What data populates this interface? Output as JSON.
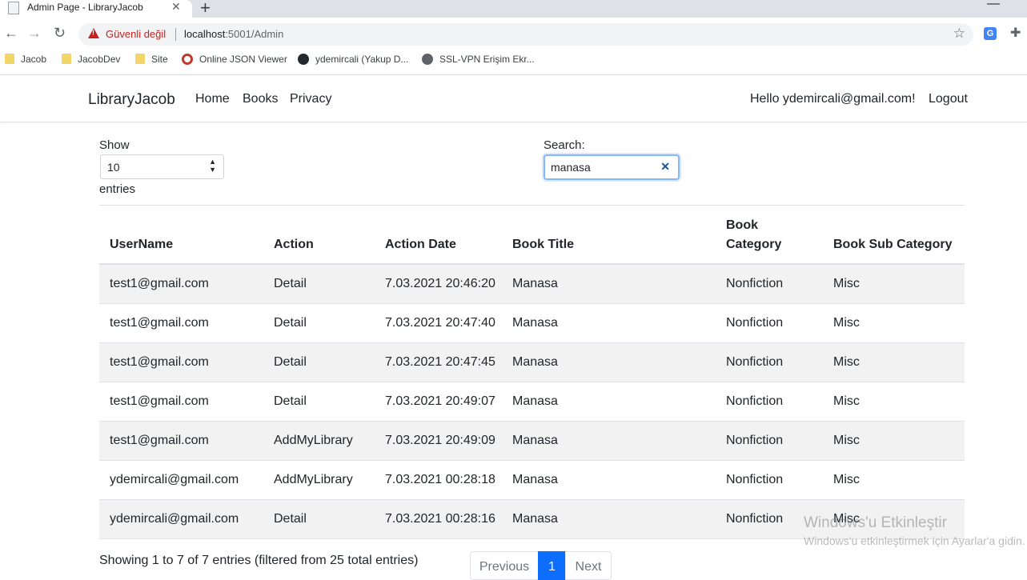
{
  "browser": {
    "tab_title": "Admin Page - LibraryJacob",
    "insecure_label": "Güvenli değil",
    "url_host": "localhost",
    "url_path": ":5001/Admin",
    "bookmarks": [
      "Jacob",
      "JacobDev",
      "Site",
      "Online JSON Viewer",
      "ydemircali (Yakup D...",
      "SSL-VPN Erişim Ekr..."
    ]
  },
  "navbar": {
    "brand": "LibraryJacob",
    "links": [
      "Home",
      "Books",
      "Privacy"
    ],
    "greeting": "Hello ydemircali@gmail.com!",
    "logout": "Logout"
  },
  "controls": {
    "show_label": "Show",
    "length_value": "10",
    "entries_label": "entries",
    "search_label": "Search:",
    "search_value": "manasa"
  },
  "table": {
    "headers": [
      "UserName",
      "Action",
      "Action Date",
      "Book Title",
      "Book Category",
      "Book Sub Category"
    ],
    "rows": [
      [
        "test1@gmail.com",
        "Detail",
        "7.03.2021 20:46:20",
        "Manasa",
        "Nonfiction",
        "Misc"
      ],
      [
        "test1@gmail.com",
        "Detail",
        "7.03.2021 20:47:40",
        "Manasa",
        "Nonfiction",
        "Misc"
      ],
      [
        "test1@gmail.com",
        "Detail",
        "7.03.2021 20:47:45",
        "Manasa",
        "Nonfiction",
        "Misc"
      ],
      [
        "test1@gmail.com",
        "Detail",
        "7.03.2021 20:49:07",
        "Manasa",
        "Nonfiction",
        "Misc"
      ],
      [
        "test1@gmail.com",
        "AddMyLibrary",
        "7.03.2021 20:49:09",
        "Manasa",
        "Nonfiction",
        "Misc"
      ],
      [
        "ydemircali@gmail.com",
        "AddMyLibrary",
        "7.03.2021 00:28:18",
        "Manasa",
        "Nonfiction",
        "Misc"
      ],
      [
        "ydemircali@gmail.com",
        "Detail",
        "7.03.2021 00:28:16",
        "Manasa",
        "Nonfiction",
        "Misc"
      ]
    ]
  },
  "footer": {
    "info": "Showing 1 to 7 of 7 entries (filtered from 25 total entries)",
    "prev": "Previous",
    "current_page": "1",
    "next": "Next"
  },
  "watermark": {
    "line1": "Windows'u Etkinleştir",
    "line2": "Windows'u etkinleştirmek için Ayarlar'a gidin."
  },
  "colors": {
    "accent": "#0d6efd",
    "stripe": "#f2f2f2",
    "insecure": "#c5221f"
  }
}
